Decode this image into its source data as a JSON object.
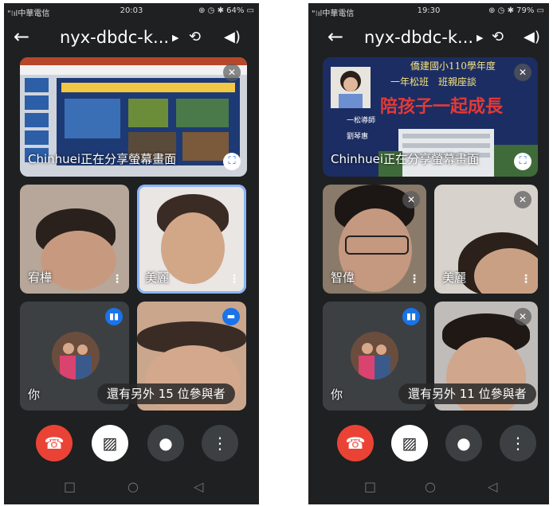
{
  "phones": [
    {
      "status": {
        "carrier": "\"⁝ıl中華電信",
        "time": "20:03",
        "sys": "⊕ ◷ ✱ 64% ▭"
      },
      "title": "nyx-dbdc-k...",
      "share_text": "Chinhuei正在分享螢幕畫面",
      "participants": [
        "宥樺",
        "美麗",
        "你"
      ],
      "more_text": "還有另外 15 位參與者"
    },
    {
      "status": {
        "carrier": "\"⁝ıl中華電信",
        "time": "19:30",
        "sys": "⊕ ◷ ✱ 79% ▭"
      },
      "title": "nyx-dbdc-k...",
      "share_text": "Chinhuei正在分享螢幕畫面",
      "participants": [
        "智偉",
        "美麗",
        "你"
      ],
      "more_text": "還有另外 11 位參與者",
      "slide": {
        "line1": "僑建國小110學年度",
        "line2": "一年松班　班親座談",
        "line3": "陪孩子一起成長",
        "teacher_title": "一松導師",
        "teacher_name": "劉琴惠"
      }
    }
  ],
  "icons": {
    "back": "arrow-back-icon",
    "caret": "caret-right-icon",
    "switch_camera": "switch-camera-icon",
    "speaker": "speaker-icon",
    "mic_off": "mic-off-icon",
    "fullscreen": "fullscreen-icon",
    "more": "more-vert-icon",
    "end_call": "end-call-icon",
    "camera_off": "camera-off-icon",
    "mic": "mic-icon",
    "speaking": "speaking-indicator-icon"
  },
  "colors": {
    "end_call": "#ea4335",
    "accent": "#1a73e8",
    "background": "#1f2021"
  }
}
